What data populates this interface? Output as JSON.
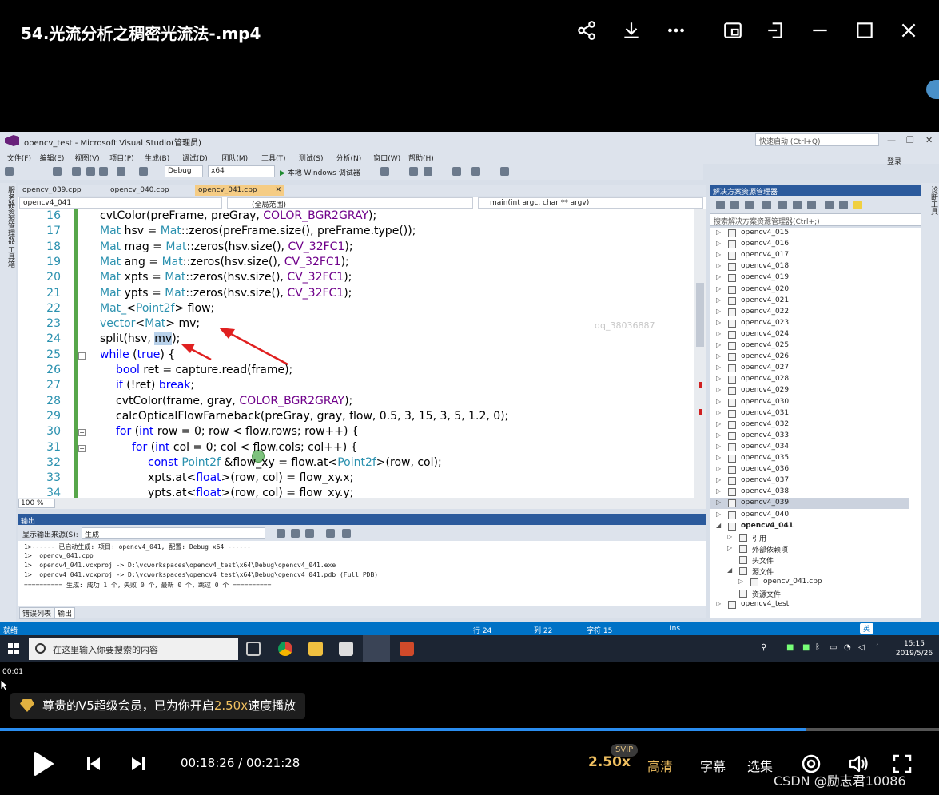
{
  "player": {
    "title": "54.光流分析之稠密光流法-.mp4",
    "icons": [
      "share-icon",
      "download-icon",
      "more-icon",
      "pip-icon",
      "pin-icon",
      "minimize-icon",
      "maximize-icon",
      "close-icon"
    ],
    "small_time": "00:01",
    "vip_prefix": "尊贵的V5超级会员，已为你开启",
    "vip_speed": "2.50x",
    "vip_suffix": "速度播放",
    "current_time": "00:18:26",
    "time_separator": " / ",
    "total_time": "00:21:28",
    "progress": 0.858,
    "speed": "2.50x",
    "svip_badge": "SVIP",
    "quality": "高清",
    "subtitles": "字幕",
    "episodes": "选集",
    "watermark": "CSDN @励志君10086"
  },
  "vs": {
    "title": "opencv_test - Microsoft Visual Studio(管理员)",
    "quick_launch": "快速启动 (Ctrl+Q)",
    "login": "登录",
    "menu": [
      "文件(F)",
      "编辑(E)",
      "视图(V)",
      "项目(P)",
      "生成(B)",
      "调试(D)",
      "团队(M)",
      "工具(T)",
      "测试(S)",
      "分析(N)",
      "窗口(W)",
      "帮助(H)"
    ],
    "config": "Debug",
    "platform": "x64",
    "run_label": "本地 Windows 调试器",
    "left_strip": "服务器资源管理器  工具箱",
    "right_strip": "诊断工具",
    "tabs": [
      "opencv_039.cpp",
      "opencv_040.cpp",
      "opencv_041.cpp"
    ],
    "nav_project": "opencv4_041",
    "nav_scope": "(全局范围)",
    "nav_function": "main(int argc, char ** argv)",
    "zoom": "100 %",
    "editor_watermark": "qq_38036887",
    "output_title": "输出",
    "output_source_label": "显示输出来源(S):",
    "output_source_value": "生成",
    "output_lines": [
      "1>------ 已启动生成: 项目: opencv4_041, 配置: Debug x64 ------",
      "1>  opencv_041.cpp",
      "1>  opencv4_041.vcxproj -> D:\\vcworkspaces\\opencv4_test\\x64\\Debug\\opencv4_041.exe",
      "1>  opencv4_041.vcxproj -> D:\\vcworkspaces\\opencv4_test\\x64\\Debug\\opencv4_041.pdb (Full PDB)",
      "========== 生成: 成功 1 个，失败 0 个，最新 0 个，跳过 0 个 =========="
    ],
    "output_tabs": [
      "错误列表",
      "输出"
    ],
    "se_title": "解决方案资源管理器",
    "se_search": "搜索解决方案资源管理器(Ctrl+;)",
    "se_items": [
      {
        "label": "opencv4_015",
        "arrow": "▷"
      },
      {
        "label": "opencv4_016",
        "arrow": "▷"
      },
      {
        "label": "opencv4_017",
        "arrow": "▷"
      },
      {
        "label": "opencv4_018",
        "arrow": "▷"
      },
      {
        "label": "opencv4_019",
        "arrow": "▷"
      },
      {
        "label": "opencv4_020",
        "arrow": "▷"
      },
      {
        "label": "opencv4_021",
        "arrow": "▷"
      },
      {
        "label": "opencv4_022",
        "arrow": "▷"
      },
      {
        "label": "opencv4_023",
        "arrow": "▷"
      },
      {
        "label": "opencv4_024",
        "arrow": "▷"
      },
      {
        "label": "opencv4_025",
        "arrow": "▷"
      },
      {
        "label": "opencv4_026",
        "arrow": "▷"
      },
      {
        "label": "opencv4_027",
        "arrow": "▷"
      },
      {
        "label": "opencv4_028",
        "arrow": "▷"
      },
      {
        "label": "opencv4_029",
        "arrow": "▷"
      },
      {
        "label": "opencv4_030",
        "arrow": "▷"
      },
      {
        "label": "opencv4_031",
        "arrow": "▷"
      },
      {
        "label": "opencv4_032",
        "arrow": "▷"
      },
      {
        "label": "opencv4_033",
        "arrow": "▷"
      },
      {
        "label": "opencv4_034",
        "arrow": "▷"
      },
      {
        "label": "opencv4_035",
        "arrow": "▷"
      },
      {
        "label": "opencv4_036",
        "arrow": "▷"
      },
      {
        "label": "opencv4_037",
        "arrow": "▷"
      },
      {
        "label": "opencv4_038",
        "arrow": "▷"
      },
      {
        "label": "opencv4_039",
        "arrow": "▷"
      },
      {
        "label": "opencv4_040",
        "arrow": "▷"
      },
      {
        "label": "opencv4_041",
        "arrow": "◢"
      },
      {
        "label": "引用",
        "arrow": "▷"
      },
      {
        "label": "外部依赖项",
        "arrow": "▷"
      },
      {
        "label": "头文件",
        "arrow": ""
      },
      {
        "label": "源文件",
        "arrow": "◢"
      },
      {
        "label": "opencv_041.cpp",
        "arrow": "▷"
      },
      {
        "label": "资源文件",
        "arrow": ""
      },
      {
        "label": "opencv4_test",
        "arrow": "▷"
      }
    ],
    "status_ready": "就绪",
    "status_row": "行 24",
    "status_col": "列 22",
    "status_char": "字符 15",
    "status_ins": "Ins",
    "taskbar_search": "在这里输入你要搜索的内容",
    "clock_time": "15:15",
    "clock_date": "2019/5/26",
    "ime": "英"
  },
  "code": [
    {
      "n": "16",
      "indent": 0,
      "html": "cvtColor(preFrame, preGray, <span class=\"mc\">COLOR_BGR2GRAY</span>);"
    },
    {
      "n": "17",
      "indent": 0,
      "html": "<span class=\"ty\">Mat</span> hsv = <span class=\"ty\">Mat</span>::zeros(preFrame.size(), preFrame.type());"
    },
    {
      "n": "18",
      "indent": 0,
      "html": "<span class=\"ty\">Mat</span> mag = <span class=\"ty\">Mat</span>::zeros(hsv.size(), <span class=\"mc\">CV_32FC1</span>);"
    },
    {
      "n": "19",
      "indent": 0,
      "html": "<span class=\"ty\">Mat</span> ang = <span class=\"ty\">Mat</span>::zeros(hsv.size(), <span class=\"mc\">CV_32FC1</span>);"
    },
    {
      "n": "20",
      "indent": 0,
      "html": "<span class=\"ty\">Mat</span> xpts = <span class=\"ty\">Mat</span>::zeros(hsv.size(), <span class=\"mc\">CV_32FC1</span>);"
    },
    {
      "n": "21",
      "indent": 0,
      "html": "<span class=\"ty\">Mat</span> ypts = <span class=\"ty\">Mat</span>::zeros(hsv.size(), <span class=\"mc\">CV_32FC1</span>);"
    },
    {
      "n": "22",
      "indent": 0,
      "html": "<span class=\"ty\">Mat_</span>&lt;<span class=\"ty\">Point2f</span>&gt; flow;"
    },
    {
      "n": "23",
      "indent": 0,
      "html": "<span class=\"ty\">vector</span>&lt;<span class=\"ty\">Mat</span>&gt; mv;"
    },
    {
      "n": "24",
      "indent": 0,
      "html": "split(hsv, <span class=\"hl\">mv</span>);"
    },
    {
      "n": "25",
      "indent": 0,
      "fold": true,
      "html": "<span class=\"kw\">while</span> (<span class=\"kw\">true</span>) {"
    },
    {
      "n": "26",
      "indent": 1,
      "html": "<span class=\"kw\">bool</span> ret = capture.read(frame);"
    },
    {
      "n": "27",
      "indent": 1,
      "html": "<span class=\"kw\">if</span> (!ret) <span class=\"kw\">break</span>;"
    },
    {
      "n": "28",
      "indent": 1,
      "html": "cvtColor(frame, gray, <span class=\"mc\">COLOR_BGR2GRAY</span>);"
    },
    {
      "n": "29",
      "indent": 1,
      "html": "calcOpticalFlowFarneback(preGray, gray, flow, 0.5, 3, 15, 3, 5, 1.2, 0);"
    },
    {
      "n": "30",
      "indent": 1,
      "fold": true,
      "html": "<span class=\"kw\">for</span> (<span class=\"kw\">int</span> row = 0; row &lt; flow.rows; row++) {"
    },
    {
      "n": "31",
      "indent": 2,
      "fold": true,
      "html": "<span class=\"kw\">for</span> (<span class=\"kw\">int</span> col = 0; col &lt; flow.cols; col++) {"
    },
    {
      "n": "32",
      "indent": 3,
      "html": "<span class=\"kw\">const</span> <span class=\"ty\">Point2f</span> &amp;flow_xy = flow.at&lt;<span class=\"ty\">Point2f</span>&gt;(row, col);"
    },
    {
      "n": "33",
      "indent": 3,
      "html": "xpts.at&lt;<span class=\"kw\">float</span>&gt;(row, col) = flow_xy.x;"
    },
    {
      "n": "34",
      "indent": 3,
      "html": "ypts.at&lt;<span class=\"kw\">float</span>&gt;(row, col) = flow_xy.y;"
    }
  ]
}
